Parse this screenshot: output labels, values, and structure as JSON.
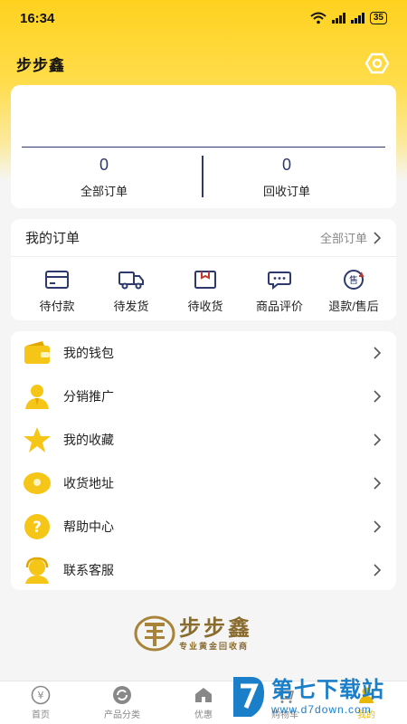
{
  "status_bar": {
    "time": "16:34",
    "battery": "35"
  },
  "header": {
    "title": "步步鑫",
    "settings_icon": "hexagon-settings-icon"
  },
  "stats": {
    "all_orders": {
      "count": "0",
      "label": "全部订单"
    },
    "recycle_orders": {
      "count": "0",
      "label": "回收订单"
    }
  },
  "my_orders": {
    "title": "我的订单",
    "view_all": "全部订单",
    "items": [
      {
        "label": "待付款",
        "icon": "card-icon"
      },
      {
        "label": "待发货",
        "icon": "truck-icon"
      },
      {
        "label": "待收货",
        "icon": "box-icon"
      },
      {
        "label": "商品评价",
        "icon": "comment-icon"
      },
      {
        "label": "退款/售后",
        "icon": "after-sale-icon"
      }
    ]
  },
  "menu": [
    {
      "label": "我的钱包",
      "icon": "wallet-icon"
    },
    {
      "label": "分销推广",
      "icon": "person-icon"
    },
    {
      "label": "我的收藏",
      "icon": "star-icon"
    },
    {
      "label": "收货地址",
      "icon": "location-icon"
    },
    {
      "label": "帮助中心",
      "icon": "help-icon"
    },
    {
      "label": "联系客服",
      "icon": "headset-icon"
    }
  ],
  "brand": {
    "name": "步步鑫",
    "slogan": "专业黄金回收商"
  },
  "tabbar": [
    {
      "label": "首页",
      "icon": "yuan-icon"
    },
    {
      "label": "产品分类",
      "icon": "refresh-icon"
    },
    {
      "label": "优惠",
      "icon": "home-icon"
    },
    {
      "label": "购物车",
      "icon": "cart-icon"
    },
    {
      "label": "我的",
      "icon": "user-icon"
    }
  ],
  "watermark": {
    "name": "第七下载站",
    "url": "www.d7down.com"
  },
  "colors": {
    "accent": "#ffd21f",
    "navy": "#2d3a6b",
    "gold": "#f5c518",
    "watermark": "#1a7ec8"
  }
}
